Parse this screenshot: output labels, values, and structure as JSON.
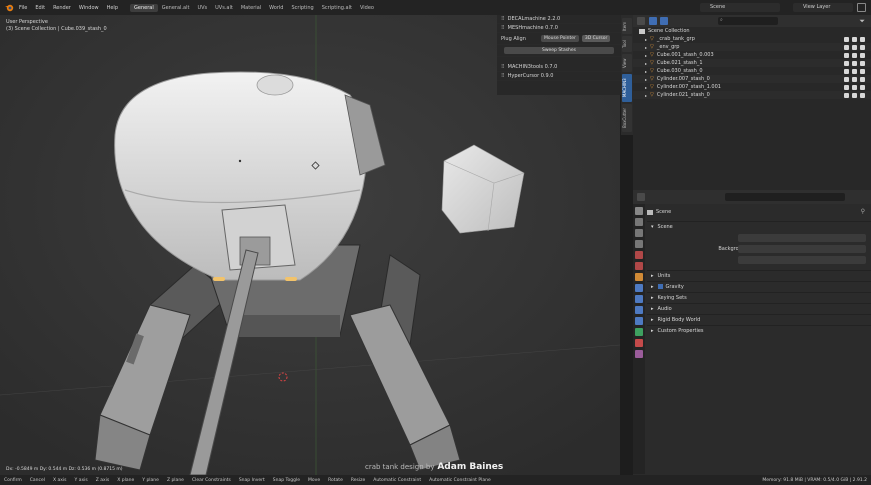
{
  "menu": [
    "File",
    "Edit",
    "Render",
    "Window",
    "Help"
  ],
  "workspaces": [
    {
      "label": "General",
      "active": true
    },
    {
      "label": "General.alt",
      "active": false
    },
    {
      "label": "UVs",
      "active": false
    },
    {
      "label": "UVs.alt",
      "active": false
    },
    {
      "label": "Material",
      "active": false
    },
    {
      "label": "World",
      "active": false
    },
    {
      "label": "Scripting",
      "active": false
    },
    {
      "label": "Scripting.alt",
      "active": false
    },
    {
      "label": "Video",
      "active": false
    }
  ],
  "scene_selector": "Scene",
  "view_layer": "View Layer",
  "viewport": {
    "mode": "User Perspective",
    "collection": "(3) Scene Collection | Cube.039_stash_0"
  },
  "npanel": {
    "decal": "DECALmachine 2.2.0",
    "mesh": "MESHmachine 0.7.0",
    "plug_align": "Plug Align",
    "mouse_pointer": "Mouse Pointer",
    "cursor_3d": "3D Cursor",
    "sweep_stashes": "Sweep Stashes",
    "machin3tools": "MACHIN3tools 0.7.0",
    "hypercursor": "HyperCursor 0.9.0"
  },
  "sidetabs": [
    "Item",
    "Tool",
    "View",
    "MACHIN3",
    "BoxCutter"
  ],
  "outliner": {
    "root": "Scene Collection",
    "rows": [
      "_crab_tank_grp",
      "_env_grp",
      "Cube.001_stash_0.003",
      "Cube.021_stash_1",
      "Cube.030_stash_0",
      "Cylinder.007_stash_0",
      "Cylinder.007_stash_1.001",
      "Cylinder.021_stash_0"
    ]
  },
  "properties": {
    "context": "Scene",
    "section_scene": "Scene",
    "camera_label": "Camera",
    "background_label": "Background Scene",
    "clip_label": "Active Clip",
    "units": "Units",
    "gravity": "Gravity",
    "keying": "Keying Sets",
    "audio": "Audio",
    "rigid": "Rigid Body World",
    "custom": "Custom Properties"
  },
  "status": {
    "dims": "Dx: -0.5849 m   Dy: 0.544 m   Dz: 0.536 m (0.8715 m)",
    "items": [
      "Confirm",
      "Cancel",
      "X axis",
      "Y axis",
      "Z axis",
      "X plane",
      "Y plane",
      "Z plane",
      "Clear Constraints",
      "Snap Invert",
      "Snap Toggle",
      "Move",
      "Rotate",
      "Resize",
      "Automatic Constraint",
      "Automatic Constraint Plane"
    ],
    "memory": "Memory: 91.8 MiB | VRAM: 0.5/4.0 GiB | 2.91.2"
  },
  "watermark": {
    "prefix": "crab tank design by",
    "author": "Adam Baines"
  },
  "colors": {
    "accent": "#3f6db3",
    "viewport_bg": "#353535",
    "panel_bg": "#2b2b2b"
  }
}
